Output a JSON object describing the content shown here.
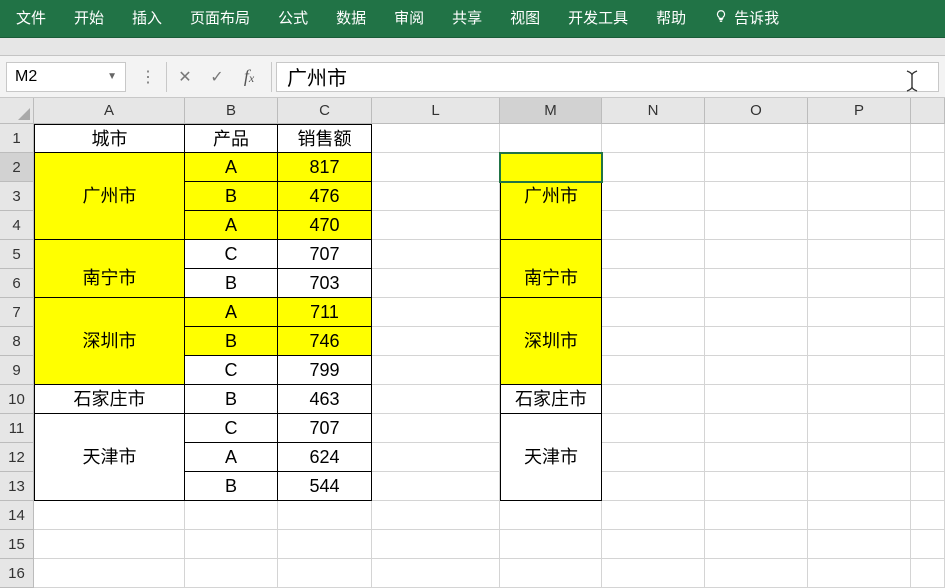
{
  "ribbon": {
    "tabs": [
      "文件",
      "开始",
      "插入",
      "页面布局",
      "公式",
      "数据",
      "审阅",
      "共享",
      "视图",
      "开发工具",
      "帮助"
    ],
    "tell_me": "告诉我"
  },
  "formula_bar": {
    "name_box": "M2",
    "formula_value": "广州市"
  },
  "columns": [
    "A",
    "B",
    "C",
    "L",
    "M",
    "N",
    "O",
    "P"
  ],
  "rows": [
    "1",
    "2",
    "3",
    "4",
    "5",
    "6",
    "7",
    "8",
    "9",
    "10",
    "11",
    "12",
    "13",
    "14",
    "15",
    "16"
  ],
  "headers": {
    "city": "城市",
    "product": "产品",
    "sales": "销售额"
  },
  "table": [
    {
      "city": "广州市",
      "rows": [
        [
          "A",
          "817"
        ],
        [
          "B",
          "476"
        ],
        [
          "A",
          "470"
        ]
      ],
      "yellow": [
        true,
        true,
        true
      ]
    },
    {
      "city": "南宁市",
      "rows": [
        [
          "C",
          "707"
        ],
        [
          "B",
          "703"
        ]
      ],
      "yellow": [
        false,
        false
      ]
    },
    {
      "city": "深圳市",
      "rows": [
        [
          "A",
          "711"
        ],
        [
          "B",
          "746"
        ],
        [
          "C",
          "799"
        ]
      ],
      "yellow": [
        true,
        true,
        false
      ]
    },
    {
      "city": "石家庄市",
      "rows": [
        [
          "B",
          "463"
        ]
      ],
      "yellow": [
        false
      ]
    },
    {
      "city": "天津市",
      "rows": [
        [
          "C",
          "707"
        ],
        [
          "A",
          "624"
        ],
        [
          "B",
          "544"
        ]
      ],
      "yellow": [
        false,
        false,
        false
      ]
    }
  ],
  "colM_groups": [
    {
      "value": "广州市",
      "span": 3,
      "yellow": true
    },
    {
      "value": "南宁市",
      "span": 2,
      "yellow": true
    },
    {
      "value": "深圳市",
      "span": 3,
      "yellow": true
    },
    {
      "value": "石家庄市",
      "span": 1,
      "yellow": false
    },
    {
      "value": "天津市",
      "span": 3,
      "yellow": false
    }
  ],
  "active_cell": {
    "ref": "M2",
    "value": "广州市"
  }
}
